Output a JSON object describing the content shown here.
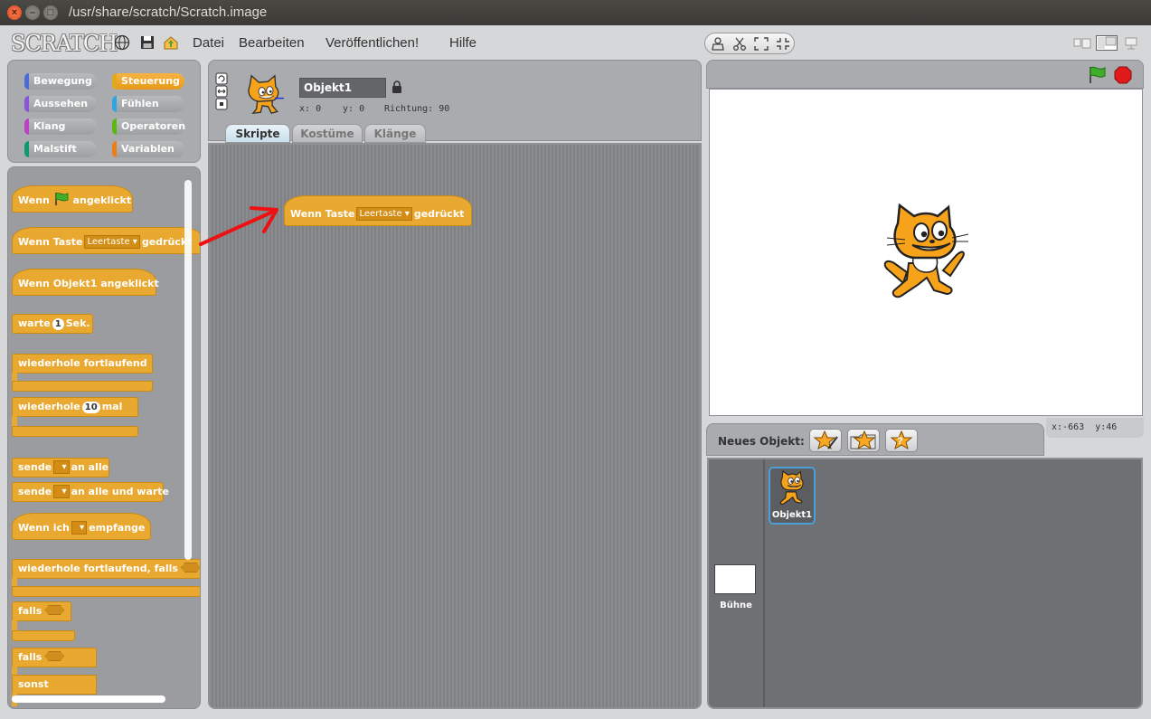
{
  "window": {
    "title": "/usr/share/scratch/Scratch.image",
    "close": "×",
    "minimize": "–",
    "maximize": "□"
  },
  "app": {
    "logo": "SCRATCH"
  },
  "menu": {
    "file": "Datei",
    "edit": "Bearbeiten",
    "share": "Veröffentlichen!",
    "help": "Hilfe"
  },
  "categories": {
    "motion": "Bewegung",
    "control": "Steuerung",
    "looks": "Aussehen",
    "sensing": "Fühlen",
    "sound": "Klang",
    "operators": "Operatoren",
    "pen": "Malstift",
    "variables": "Variablen",
    "active": "Steuerung"
  },
  "palette": {
    "when_flag_1": "Wenn",
    "when_flag_2": "angeklickt",
    "when_key_1": "Wenn Taste",
    "when_key_dd": "Leertaste",
    "when_key_2": "gedrückt",
    "when_clicked": "Wenn  Objekt1  angeklickt",
    "wait_1": "warte",
    "wait_val": "1",
    "wait_2": "Sek.",
    "forever": "wiederhole fortlaufend",
    "repeat_1": "wiederhole",
    "repeat_val": "10",
    "repeat_2": "mal",
    "broadcast_1": "sende",
    "broadcast_2": "an alle",
    "broadcast_wait_2": "an alle und warte",
    "receive_1": "Wenn ich",
    "receive_2": "empfange",
    "forever_if": "wiederhole fortlaufend, falls",
    "if": "falls",
    "if_else_1": "falls",
    "else": "sonst"
  },
  "sprite": {
    "name": "Objekt1",
    "x_label": "x:",
    "x": "0",
    "y_label": "y:",
    "y": "0",
    "dir_label": "Richtung:",
    "direction": "90"
  },
  "tabs": {
    "scripts": "Skripte",
    "costumes": "Kostüme",
    "sounds": "Klänge",
    "active": "Skripte"
  },
  "script": {
    "part1": "Wenn Taste",
    "key": "Leertaste",
    "part2": "gedrückt"
  },
  "stage": {
    "mouse_x_label": "x:",
    "mouse_x": "-663",
    "mouse_y_label": "y:",
    "mouse_y": "46"
  },
  "new_sprite": {
    "label": "Neues Objekt:"
  },
  "sprites_list": {
    "stage_label": "Bühne",
    "sprite_label": "Objekt1"
  },
  "colors": {
    "control": "#e9a830",
    "motion": "#4a6cd4",
    "looks": "#8a55d7",
    "sound": "#bb42c3",
    "pen": "#0e9a6c",
    "sensing": "#2ca5e2",
    "operators": "#5cb712",
    "variables": "#ee7d16",
    "arrow": "#ee1111",
    "cat": "#f7a21b"
  }
}
